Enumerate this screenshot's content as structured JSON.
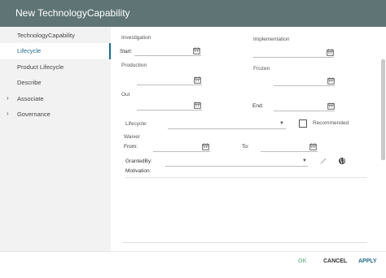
{
  "window": {
    "title": "New TechnologyCapability"
  },
  "sidebar": {
    "items": [
      {
        "label": "TechnologyCapability"
      },
      {
        "label": "Lifecycle",
        "active": true
      },
      {
        "label": "Product Lifecycle"
      },
      {
        "label": "Describe"
      },
      {
        "label": "Associate",
        "expandable": true
      },
      {
        "label": "Governance",
        "expandable": true
      }
    ]
  },
  "form": {
    "investigation_label": "Investigation",
    "start_label": "Start:",
    "start_value": "",
    "implementation_label": "Implementation",
    "implementation_value": "",
    "production_label": "Production",
    "production_value": "",
    "frozen_label": "Frozen",
    "frozen_value": "",
    "out_label": "Out",
    "out_value": "",
    "end_label": "End:",
    "end_value": "",
    "lifecycle_label": "Lifecycle:",
    "lifecycle_value": "",
    "recommended_label": "Recommended",
    "recommended_checked": false,
    "waiver_label": "Waiver",
    "from_label": "From:",
    "from_value": "",
    "to_label": "To:",
    "to_value": "",
    "granted_by_label": "GrantedBy:",
    "granted_by_value": "",
    "motivation_label": "Motivation:",
    "motivation_value": ""
  },
  "footer": {
    "ok_label": "OK",
    "cancel_label": "CANCEL",
    "apply_label": "APPLY"
  },
  "colors": {
    "titlebar": "#5f7474",
    "accent": "#1f6a8a",
    "ok_disabled": "#7fbf9a"
  },
  "icons": [
    "calendar-icon",
    "chevron-right-icon",
    "chevron-down-icon",
    "pencil-icon",
    "globe-icon"
  ]
}
